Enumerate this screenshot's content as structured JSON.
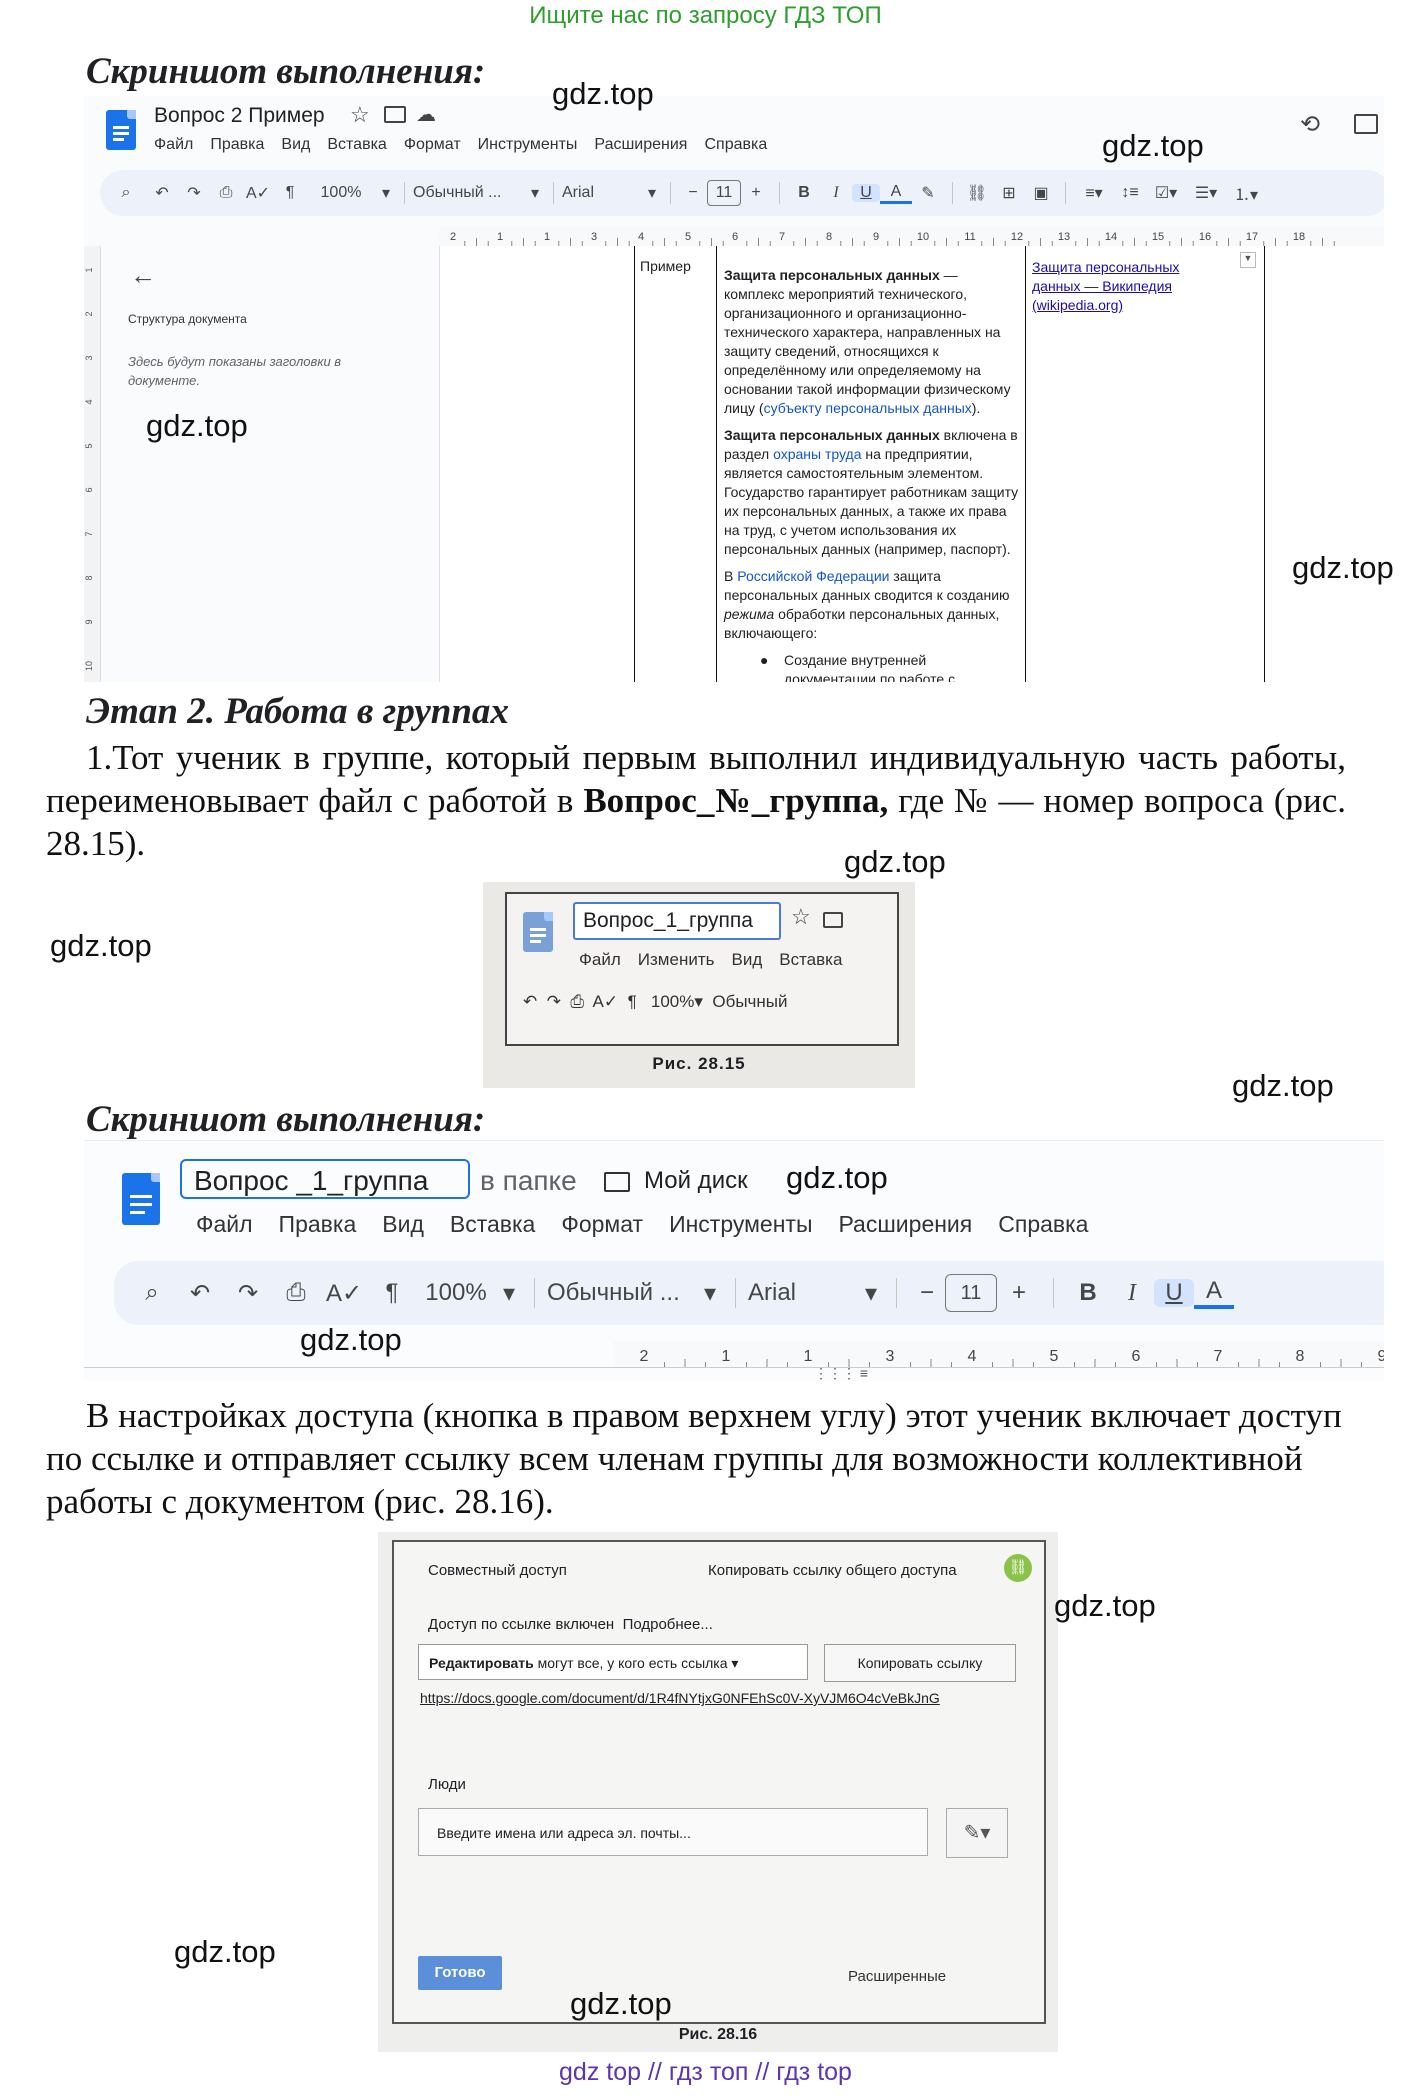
{
  "banner_top": "Ищите нас по запросу ГДЗ ТОП",
  "banner_bottom": "gdz top  //  гдз топ  //  гдз top",
  "watermark": "gdz.top",
  "heading1": "Скриншот выполнения:",
  "shot1": {
    "doc_title": "Вопрос 2 Пример",
    "menu": [
      "Файл",
      "Правка",
      "Вид",
      "Вставка",
      "Формат",
      "Инструменты",
      "Расширения",
      "Справка"
    ],
    "zoom": "100%",
    "style": "Обычный ...",
    "font": "Arial",
    "font_size": "11",
    "ruler_ticks": [
      "2",
      "1",
      "1",
      "3",
      "4",
      "5",
      "6",
      "7",
      "8",
      "9",
      "10",
      "11",
      "12",
      "13",
      "14",
      "15",
      "16",
      "17",
      "18"
    ],
    "outline_title": "Структура документа",
    "outline_hint": "Здесь будут показаны заголовки в документе.",
    "vertical_ruler": [
      "1",
      "2",
      "3",
      "4",
      "5",
      "6",
      "7",
      "8",
      "9",
      "10"
    ],
    "cell_label": "Пример",
    "p1_bold": "Защита персональных данных",
    "p1_text": " — комплекс мероприятий технического, организационного и организационно-технического характера, направленных на защиту сведений, относящихся к определённому или определяемому на основании такой информации физическому лицу (",
    "p1_link": "субъекту персональных данных",
    "p1_end": ").",
    "p2_bold": "Защита персональных данных",
    "p2_text": " включена в раздел ",
    "p2_link": "охраны труда",
    "p2_rest": " на предприятии, является самостоятельным элементом. Государство гарантирует работникам защиту их персональных данных, а также их права на труд, с учетом использования их персональных данных (например, паспорт).",
    "p3_start": "В ",
    "p3_link": "Российской Федерации",
    "p3_text": " защита персональных данных сводится к созданию ",
    "p3_italic": "режима",
    "p3_rest": " обработки персональных данных, включающего:",
    "bullet": "Создание внутренней документации по работе с персональными данными",
    "source_link": "Защита персональных данных — Википедия (wikipedia.org)"
  },
  "heading2": "Этап 2. Работа в группах",
  "para1": {
    "text": "1.Тот ученик в группе, который первым выполнил индивидуальную часть работы, переименовывает файл с работой в ",
    "bold": "Вопрос_№_группа,",
    "rest": " где № — номер вопроса (рис. 28.15)."
  },
  "fig2815": {
    "title": "Вопрос_1_группа",
    "menu": [
      "Файл",
      "Изменить",
      "Вид",
      "Вставка"
    ],
    "zoom": "100%",
    "style": "Обычный",
    "caption": "Рис. 28.15"
  },
  "heading3": "Скриншот выполнения:",
  "shot2": {
    "title": "Вопрос _1_группа",
    "folder_prefix": "в папке",
    "folder": "Мой диск",
    "menu": [
      "Файл",
      "Правка",
      "Вид",
      "Вставка",
      "Формат",
      "Инструменты",
      "Расширения",
      "Справка"
    ],
    "zoom": "100%",
    "style": "Обычный ...",
    "font": "Arial",
    "font_size": "11",
    "ruler_ticks": [
      "2",
      "1",
      "1",
      "3",
      "4",
      "5",
      "6",
      "7",
      "8",
      "9"
    ]
  },
  "para2": "В настройках доступа (кнопка в правом верхнем углу) этот ученик включает доступ по ссылке и отправляет ссылку всем членам группы для возможности коллективной работы с документом (рис. 28.16).",
  "fig2816": {
    "heading": "Совместный доступ",
    "copy_link_label": "Копировать ссылку общего доступа",
    "link_status": "Доступ по ссылке включен",
    "more": "Подробнее...",
    "permission_bold": "Редактировать",
    "permission_rest": " могут все, у кого есть ссылка",
    "copy_button": "Копировать ссылку",
    "url": "https://docs.google.com/document/d/1R4fNYtjxG0NFEhSc0V-XyVJM6O4cVeBkJnG",
    "people": "Люди",
    "email_placeholder": "Введите имена или адреса эл. почты...",
    "done_button": "Готово",
    "advanced": "Расширенные",
    "caption": "Рис. 28.16"
  }
}
